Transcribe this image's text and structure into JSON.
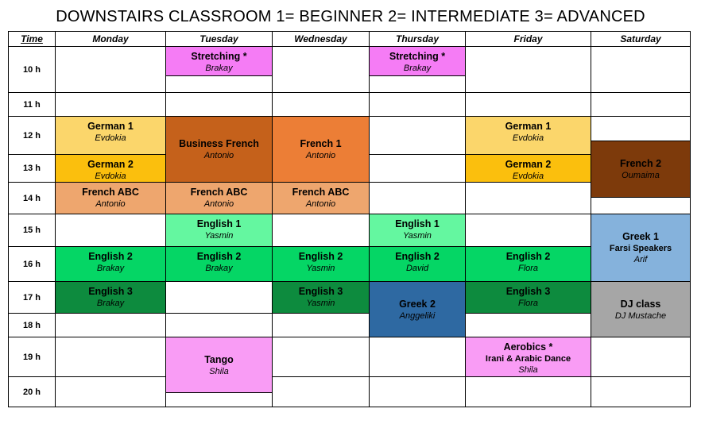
{
  "title": "DOWNSTAIRS CLASSROOM  1= BEGINNER 2= INTERMEDIATE  3= ADVANCED",
  "header": {
    "time": "Time",
    "days": [
      "Monday",
      "Tuesday",
      "Wednesday",
      "Thursday",
      "Friday",
      "Saturday"
    ]
  },
  "times": [
    "10 h",
    "11 h",
    "12 h",
    "13 h",
    "14 h",
    "15 h",
    "16 h",
    "17 h",
    "18 h",
    "19 h",
    "20 h"
  ],
  "colors": {
    "magenta": "#f57cf5",
    "yellow_light": "#fbd66b",
    "yellow": "#fbbf0d",
    "brown_orange": "#c5611b",
    "orange": "#ec7e36",
    "peach": "#eea66e",
    "dark_brown": "#7d3a0b",
    "mint": "#64f7a0",
    "green": "#05d665",
    "dark_green": "#0d8b3e",
    "blue": "#2e69a2",
    "light_blue": "#85b2dc",
    "gray": "#a6a6a6",
    "pink": "#f99cf5"
  },
  "events": [
    {
      "id": "tue-stretching",
      "title": "Stretching *",
      "teacher": "Brakay",
      "color": "#f57cf5"
    },
    {
      "id": "thu-stretching",
      "title": "Stretching *",
      "teacher": "Brakay",
      "color": "#f57cf5"
    },
    {
      "id": "mon-german1",
      "title": "German 1",
      "teacher": "Evdokia",
      "color": "#fbd66b"
    },
    {
      "id": "tue-business-french",
      "title": "Business French",
      "teacher": "Antonio",
      "color": "#c5611b"
    },
    {
      "id": "wed-french1",
      "title": "French 1",
      "teacher": "Antonio",
      "color": "#ec7e36"
    },
    {
      "id": "fri-german1",
      "title": "German 1",
      "teacher": "Evdokia",
      "color": "#fbd66b"
    },
    {
      "id": "mon-german2",
      "title": "German 2",
      "teacher": "Evdokia",
      "color": "#fbbf0d"
    },
    {
      "id": "fri-german2",
      "title": "German 2",
      "teacher": "Evdokia",
      "color": "#fbbf0d"
    },
    {
      "id": "sat-french2",
      "title": "French 2",
      "teacher": "Oumaima",
      "color": "#7d3a0b"
    },
    {
      "id": "mon-french-abc",
      "title": "French ABC",
      "teacher": "Antonio",
      "color": "#eea66e"
    },
    {
      "id": "tue-french-abc",
      "title": "French ABC",
      "teacher": "Antonio",
      "color": "#eea66e"
    },
    {
      "id": "wed-french-abc",
      "title": "French ABC",
      "teacher": "Antonio",
      "color": "#eea66e"
    },
    {
      "id": "tue-english1",
      "title": "English 1",
      "teacher": "Yasmin",
      "color": "#64f7a0"
    },
    {
      "id": "thu-english1",
      "title": "English 1",
      "teacher": "Yasmin",
      "color": "#64f7a0"
    },
    {
      "id": "sat-greek1",
      "title": "Greek 1",
      "subtitle": "Farsi Speakers",
      "teacher": "Arif",
      "color": "#85b2dc"
    },
    {
      "id": "mon-english2",
      "title": "English 2",
      "teacher": "Brakay",
      "color": "#05d665"
    },
    {
      "id": "tue-english2",
      "title": "English 2",
      "teacher": "Brakay",
      "color": "#05d665"
    },
    {
      "id": "wed-english2",
      "title": "English 2",
      "teacher": "Yasmin",
      "color": "#05d665"
    },
    {
      "id": "thu-english2",
      "title": "English 2",
      "teacher": "David",
      "color": "#05d665"
    },
    {
      "id": "fri-english2",
      "title": "English 2",
      "teacher": "Flora",
      "color": "#05d665"
    },
    {
      "id": "mon-english3",
      "title": "English 3",
      "teacher": "Brakay",
      "color": "#0d8b3e"
    },
    {
      "id": "wed-english3",
      "title": "English 3",
      "teacher": "Yasmin",
      "color": "#0d8b3e"
    },
    {
      "id": "thu-greek2",
      "title": "Greek 2",
      "teacher": "Anggeliki",
      "color": "#2e69a2"
    },
    {
      "id": "fri-english3",
      "title": "English 3",
      "teacher": "Flora",
      "color": "#0d8b3e"
    },
    {
      "id": "sat-dj",
      "title": "DJ class",
      "teacher": "DJ Mustache",
      "color": "#a6a6a6"
    },
    {
      "id": "tue-tango",
      "title": "Tango",
      "teacher": "Shila",
      "color": "#f99cf5"
    },
    {
      "id": "fri-aerobics",
      "title": "Aerobics *",
      "subtitle": "Irani & Arabic Dance",
      "teacher": "Shila",
      "color": "#f99cf5"
    }
  ]
}
